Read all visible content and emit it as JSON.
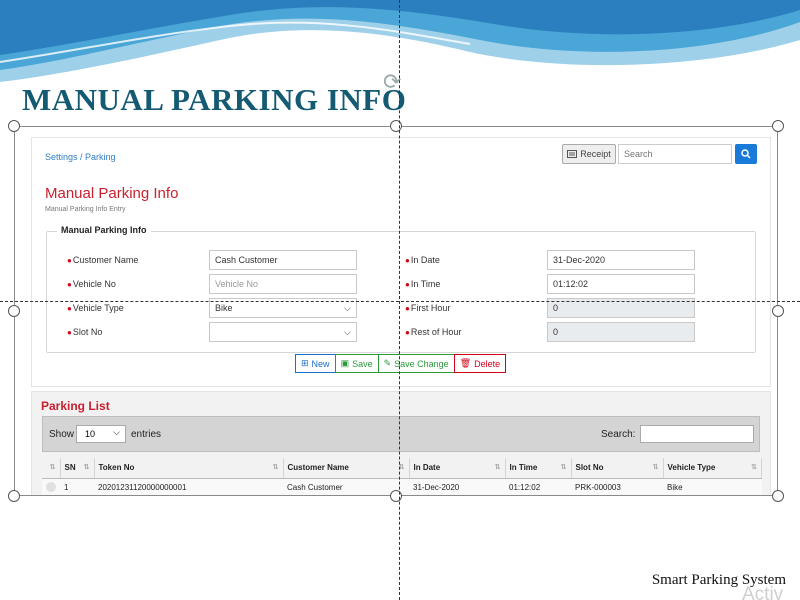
{
  "slide": {
    "title": "MANUAL PARKING INFO",
    "footer": "Smart Parking System",
    "watermark": "Activ"
  },
  "app": {
    "breadcrumb": "Settings / Parking",
    "receipt_label": "Receipt",
    "search_placeholder": "Search",
    "form_title": "Manual Parking Info",
    "form_subtitle": "Manual Parking Info Entry",
    "fieldset_legend": "Manual Parking Info",
    "fields": {
      "customer_name": {
        "label": "Customer Name",
        "value": "Cash Customer"
      },
      "vehicle_no": {
        "label": "Vehicle No",
        "placeholder": "Vehicle No"
      },
      "vehicle_type": {
        "label": "Vehicle Type",
        "value": "Bike"
      },
      "slot_no": {
        "label": "Slot No",
        "value": ""
      },
      "in_date": {
        "label": "In Date",
        "value": "31-Dec-2020"
      },
      "in_time": {
        "label": "In Time",
        "value": "01:12:02"
      },
      "first_hour": {
        "label": "First Hour",
        "value": "0"
      },
      "rest_of_hour": {
        "label": "Rest of Hour",
        "value": "0"
      }
    },
    "actions": {
      "new": "New",
      "save": "Save",
      "save_change": "Save Change",
      "delete": "Delete"
    },
    "list": {
      "title": "Parking List",
      "show_label": "Show",
      "page_size": "10",
      "entries_label": "entries",
      "search_label": "Search:",
      "columns": [
        "SN",
        "Token No",
        "Customer Name",
        "In Date",
        "In Time",
        "Slot No",
        "Vehicle Type"
      ],
      "rows": [
        [
          "1",
          "20201231120000000001",
          "Cash Customer",
          "31-Dec-2020",
          "01:12:02",
          "PRK-000003",
          "Bike"
        ]
      ]
    }
  },
  "colors": {
    "title_teal": "#145a73",
    "form_title_red": "#c8202e",
    "link_blue": "#2f7fc5",
    "primary_blue": "#1a7ad9",
    "success_green": "#2a9a3a",
    "danger_red": "#d0021b"
  },
  "icons": {
    "receipt": "receipt-icon",
    "search": "search-icon",
    "new": "plus-icon",
    "save": "floppy-icon",
    "save_change": "edit-icon",
    "delete": "trash-icon",
    "rotate": "rotate-icon",
    "sort": "sort-icon"
  }
}
